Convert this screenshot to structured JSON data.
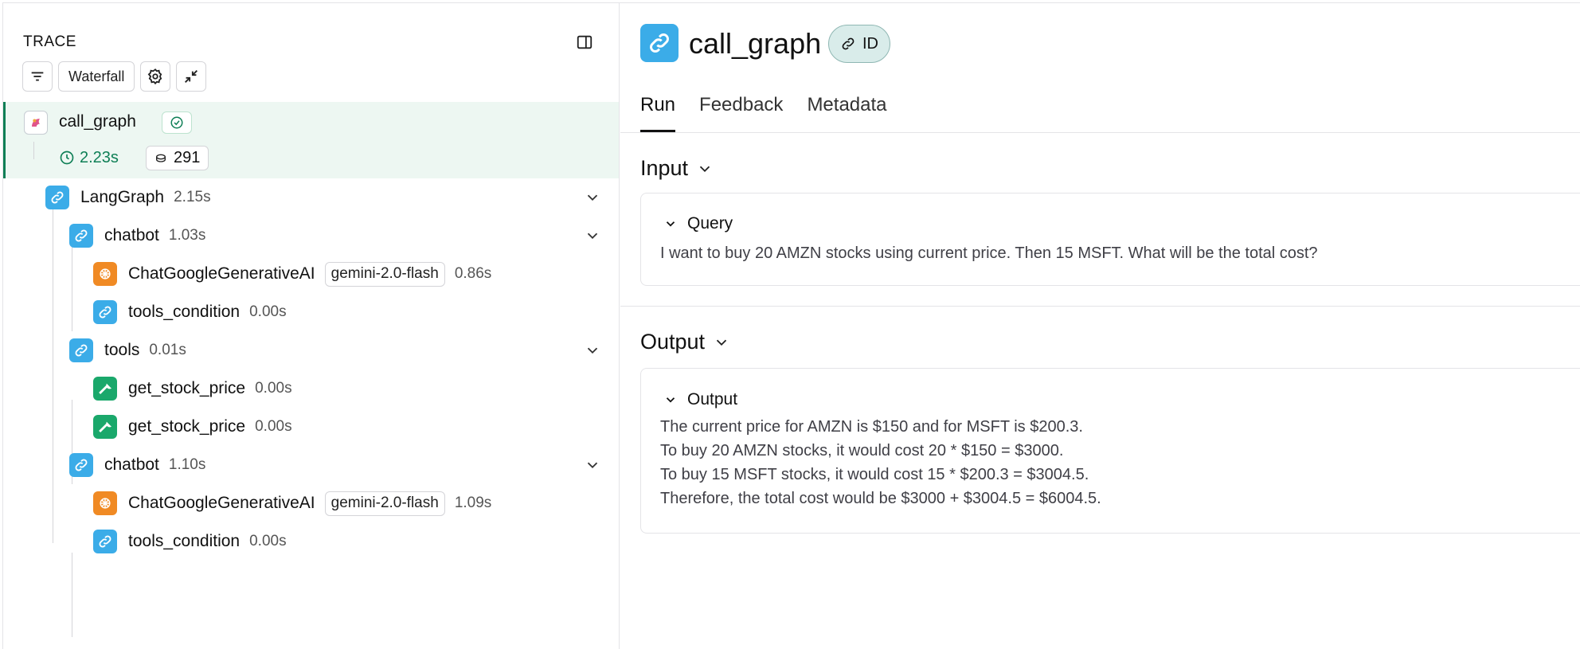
{
  "trace": {
    "title": "TRACE",
    "view_label": "Waterfall",
    "root": {
      "name": "call_graph",
      "latency": "2.23s",
      "tokens": "291"
    },
    "nodes": [
      {
        "name": "LangGraph",
        "time": "2.15s",
        "type": "chain",
        "model": ""
      },
      {
        "name": "chatbot",
        "time": "1.03s",
        "type": "chain",
        "model": ""
      },
      {
        "name": "ChatGoogleGenerativeAI",
        "time": "0.86s",
        "type": "llm",
        "model": "gemini-2.0-flash"
      },
      {
        "name": "tools_condition",
        "time": "0.00s",
        "type": "chain",
        "model": ""
      },
      {
        "name": "tools",
        "time": "0.01s",
        "type": "chain",
        "model": ""
      },
      {
        "name": "get_stock_price",
        "time": "0.00s",
        "type": "tool",
        "model": ""
      },
      {
        "name": "get_stock_price",
        "time": "0.00s",
        "type": "tool",
        "model": ""
      },
      {
        "name": "chatbot",
        "time": "1.10s",
        "type": "chain",
        "model": ""
      },
      {
        "name": "ChatGoogleGenerativeAI",
        "time": "1.09s",
        "type": "llm",
        "model": "gemini-2.0-flash"
      },
      {
        "name": "tools_condition",
        "time": "0.00s",
        "type": "chain",
        "model": ""
      }
    ]
  },
  "run": {
    "title": "call_graph",
    "id_label": "ID",
    "tabs": [
      "Run",
      "Feedback",
      "Metadata"
    ],
    "input": {
      "heading": "Input",
      "card_title": "Query",
      "text": "I want to buy 20 AMZN stocks using current price. Then 15 MSFT. What will be the total cost?"
    },
    "output": {
      "heading": "Output",
      "card_title": "Output",
      "lines": [
        "The current price for AMZN is $150 and for MSFT is $200.3.",
        "To buy 20 AMZN stocks, it would cost 20 * $150 = $3000.",
        "To buy 15 MSFT stocks, it would cost 15 * $200.3 = $3004.5.",
        "Therefore, the total cost would be $3000 + $3004.5 = $6004.5."
      ]
    }
  },
  "colors": {
    "accent_green": "#0f7f56",
    "chain_blue": "#3bace8",
    "llm_orange": "#f08a24",
    "tool_green": "#1aa86b",
    "selected_bg": "#edf7f2"
  }
}
